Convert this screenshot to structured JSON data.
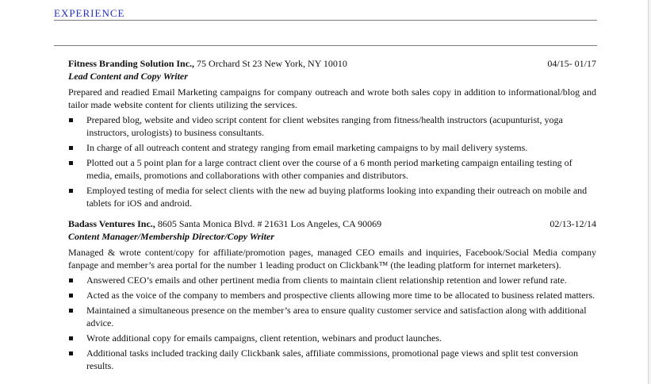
{
  "section": {
    "title": "EXPERIENCE"
  },
  "jobs": [
    {
      "company": "Fitness Branding Solution Inc.,",
      "address": " 75 Orchard St 23 New York, NY 10010",
      "dates": "04/15- 01/17",
      "role": "Lead Content and Copy Writer",
      "description": "Prepared and readied Email Marketing campaigns for company outreach and wrote both sales copy in addition to informational/blog and tailor made website content for clients utilizing the services.",
      "bullets": [
        "Prepared blog, website and video script content for client websites ranging from fitness/health instructors (acupunturist, yoga instructors, urologists) to business consultants.",
        "In charge of all outreach content and strategy ranging from email marketing campaigns to by mail delivery systems.",
        "Plotted out a 5 point plan for a large contract client over the course of a 6 month period marketing campaign entailing testing of media, emails, promotions and collaborations with other companies and distributors.",
        "Employed testing of media for select clients with the new ad buying platforms looking into expanding their outreach on mobile and tablets for iOS and android."
      ]
    },
    {
      "company": "Badass Ventures Inc.,",
      "address": " 8605 Santa Monica Blvd. # 21631 Los Angeles, CA 90069",
      "dates": "02/13-12/14",
      "role": "Content Manager/Membership Director/Copy Writer",
      "description": "Managed & wrote content/copy for affiliate/promotion pages, managed CEO emails and inquiries, Facebook/Social Media company fanpage and member’s area portal for the number 1 leading product on Clickbank™ (the leading platform for internet marketers).",
      "bullets": [
        "Answered CEO’s emails and other pertinent media from clients to maintain client relationship retention and lower refund rate.",
        "Acted as the voice of the company to members and prospective clients allowing more time to be allocated to business related matters.",
        "Maintained a simultaneous presence on the member’s area to ensure quality customer service and satisfaction along with additional advice.",
        "Wrote additional copy for emails campaigns, client retention, webinars and product launches.",
        "Additional tasks included tracking daily Clickbank sales, affiliate commissions, promotional page views and split test conversion results."
      ]
    }
  ]
}
